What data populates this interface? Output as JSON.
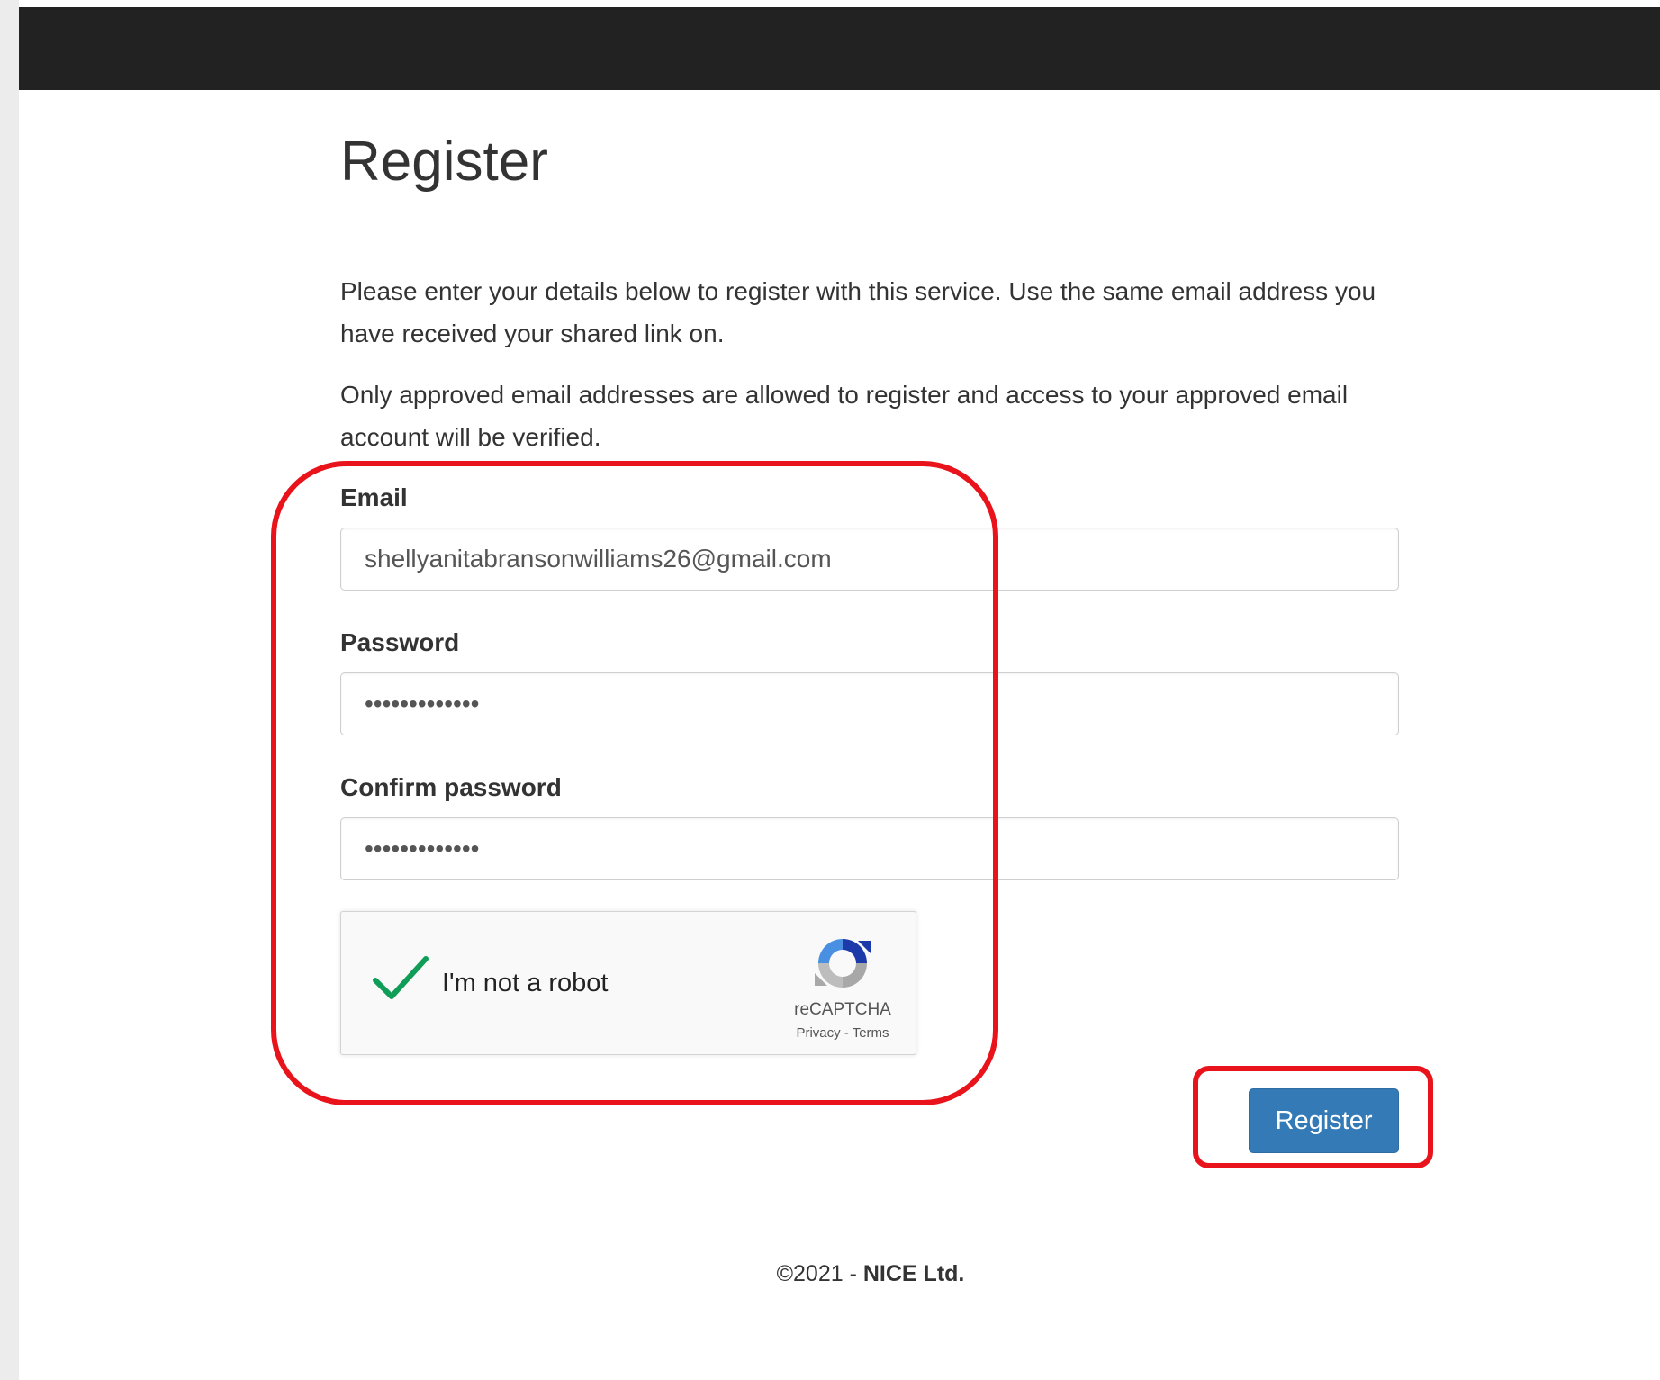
{
  "page": {
    "title": "Register",
    "intro_paragraph_1": "Please enter your details below to register with this service. Use the same email address you have received your shared link on.",
    "intro_paragraph_2": "Only approved email addresses are allowed to register and access to your approved email account will be verified."
  },
  "form": {
    "email_label": "Email",
    "email_value": "shellyanitabransonwilliams26@gmail.com",
    "password_label": "Password",
    "password_value": "•••••••••••••",
    "confirm_password_label": "Confirm password",
    "confirm_password_value": "•••••••••••••",
    "register_label": "Register"
  },
  "captcha": {
    "checked": true,
    "label": "I'm not a robot",
    "brand": "reCAPTCHA",
    "privacy_label": "Privacy",
    "separator": "-",
    "terms_label": "Terms"
  },
  "footer": {
    "copyright": "©2021 - ",
    "company": "NICE Ltd."
  },
  "colors": {
    "topbar": "#222222",
    "primary_button": "#337ab7",
    "check": "#0f9d58",
    "annotation_outline": "#e8131b"
  },
  "icons": {
    "check": "checkmark-icon",
    "captcha_logo": "recaptcha-logo-icon"
  }
}
